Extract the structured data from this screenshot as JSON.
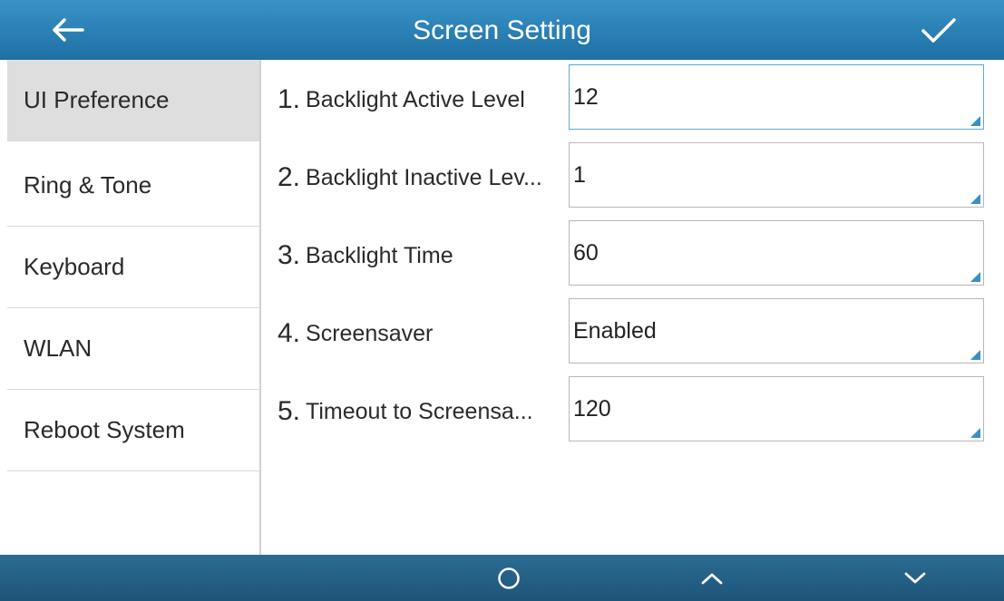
{
  "header": {
    "title": "Screen Setting",
    "back_icon": "arrow-left-icon",
    "confirm_icon": "checkmark-icon"
  },
  "sidebar": {
    "items": [
      {
        "label": "UI Preference",
        "active": true
      },
      {
        "label": "Ring & Tone",
        "active": false
      },
      {
        "label": "Keyboard",
        "active": false
      },
      {
        "label": "WLAN",
        "active": false
      },
      {
        "label": "Reboot System",
        "active": false
      }
    ]
  },
  "settings": {
    "rows": [
      {
        "num": "1.",
        "label": "Backlight Active Level",
        "value": "12"
      },
      {
        "num": "2.",
        "label": "Backlight Inactive Lev...",
        "value": "1"
      },
      {
        "num": "3.",
        "label": "Backlight Time",
        "value": "60"
      },
      {
        "num": "4.",
        "label": "Screensaver",
        "value": "Enabled"
      },
      {
        "num": "5.",
        "label": "Timeout to Screensa...",
        "value": "120"
      }
    ]
  },
  "footer": {
    "softkeys": [
      "circle-icon",
      "chevron-up-icon",
      "chevron-down-icon"
    ]
  },
  "colors": {
    "header": "#2a7fb4",
    "footer": "#1f5479",
    "accent": "#3b8fc4",
    "active_item": "#dedede"
  }
}
